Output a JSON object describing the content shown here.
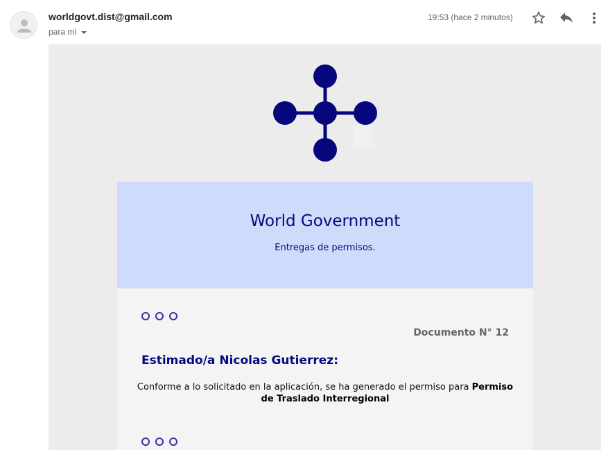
{
  "header": {
    "sender_email": "worldgovt.dist@gmail.com",
    "recipient_label": "para mí",
    "timestamp": "19:53 (hace 2 minutos)",
    "icons": [
      "person-icon",
      "star-icon",
      "reply-icon",
      "more-vert-icon"
    ]
  },
  "email": {
    "hero_title": "World Government",
    "hero_subtitle": "Entregas de permisos.",
    "document_number": "Documento N° 12",
    "greeting": "Estimado/a Nicolas Gutierrez:",
    "body_prefix": "Conforme a lo solicitado en la aplicación, se ha generado el permiso para",
    "permit_name": "Permiso de Traslado Interregional"
  },
  "colors": {
    "brand_navy": "#06077c",
    "hero_background": "#cfdbfb",
    "canvas_background": "#ececec",
    "content_background": "#f4f4f4",
    "dot_outline": "#3a2ea8"
  }
}
